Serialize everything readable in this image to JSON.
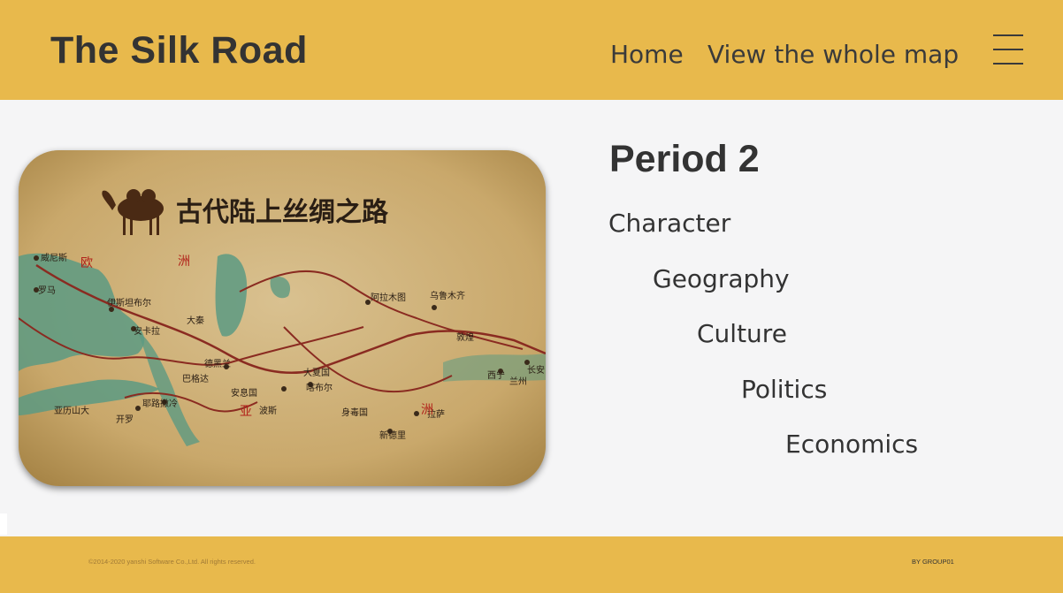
{
  "header": {
    "title": "The Silk Road",
    "nav": {
      "home": "Home",
      "map": "View the whole map"
    },
    "menu_icon": "hamburger-menu-icon",
    "background": "#e8b94c"
  },
  "hero_image": {
    "title_text": "古代陆上丝绸之路",
    "map_labels": [
      "欧",
      "洲",
      "亚",
      "洲",
      "威尼斯",
      "罗马",
      "伊斯坦布尔",
      "安卡拉",
      "亚历山大",
      "开罗",
      "耶路撒冷",
      "巴格达",
      "德黑兰",
      "安息国",
      "大夏国",
      "喀布尔",
      "阿拉木图",
      "乌鲁木齐",
      "敦煌",
      "西宁",
      "兰州",
      "长安",
      "拉萨",
      "新德里",
      "身毒国",
      "波斯",
      "大秦"
    ]
  },
  "content": {
    "period_title": "Period 2",
    "topics": [
      "Character",
      "Geography",
      "Culture",
      "Politics",
      "Economics"
    ]
  },
  "footer": {
    "copyright": "©2014-2020 yanshi Software Co.,Ltd. All rights reserved.",
    "byline": "BY  GROUP01"
  }
}
